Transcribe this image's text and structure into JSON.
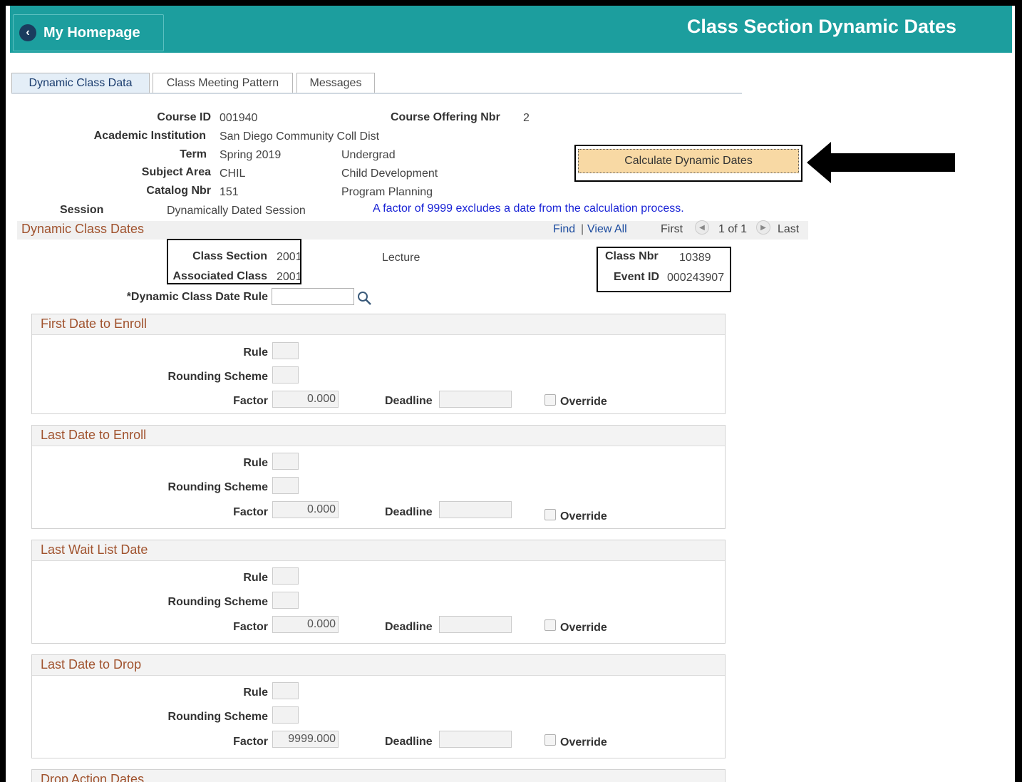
{
  "header": {
    "home_label": "My Homepage",
    "title": "Class Section Dynamic Dates"
  },
  "tabs": [
    {
      "label": "Dynamic Class Data"
    },
    {
      "label": "Class Meeting Pattern"
    },
    {
      "label": "Messages"
    }
  ],
  "course": {
    "course_id_label": "Course ID",
    "course_id": "001940",
    "offering_label": "Course Offering Nbr",
    "offering": "2",
    "institution_label": "Academic Institution",
    "institution": "San Diego Community Coll Dist",
    "term_label": "Term",
    "term": "Spring 2019",
    "career": "Undergrad",
    "subject_label": "Subject Area",
    "subject": "CHIL",
    "subject_desc": "Child Development",
    "catalog_label": "Catalog Nbr",
    "catalog": "151",
    "catalog_desc": "Program Planning",
    "session_label": "Session",
    "session": "Dynamically Dated Session",
    "note": "A factor of 9999 excludes a date from the calculation process."
  },
  "calculate_button": "Calculate Dynamic Dates",
  "dynamic": {
    "title": "Dynamic Class Dates",
    "find": "Find",
    "sep": "|",
    "view_all": "View All",
    "first": "First",
    "count": "1 of 1",
    "last": "Last",
    "class_section_label": "Class Section",
    "class_section": "2001",
    "assoc_label": "Associated Class",
    "assoc": "2001",
    "component": "Lecture",
    "class_nbr_label": "Class Nbr",
    "class_nbr": "10389",
    "event_id_label": "Event ID",
    "event_id": "000243907",
    "rule_label": "*Dynamic Class Date Rule"
  },
  "field_labels": {
    "rule": "Rule",
    "rounding": "Rounding Scheme",
    "factor": "Factor",
    "deadline": "Deadline",
    "override": "Override"
  },
  "groups": [
    {
      "title": "First Date to Enroll",
      "factor": "0.000"
    },
    {
      "title": "Last Date to Enroll",
      "factor": "0.000"
    },
    {
      "title": "Last Wait List Date",
      "factor": "0.000"
    },
    {
      "title": "Last Date to Drop",
      "factor": "9999.000"
    },
    {
      "title": "Drop Action Dates"
    }
  ]
}
